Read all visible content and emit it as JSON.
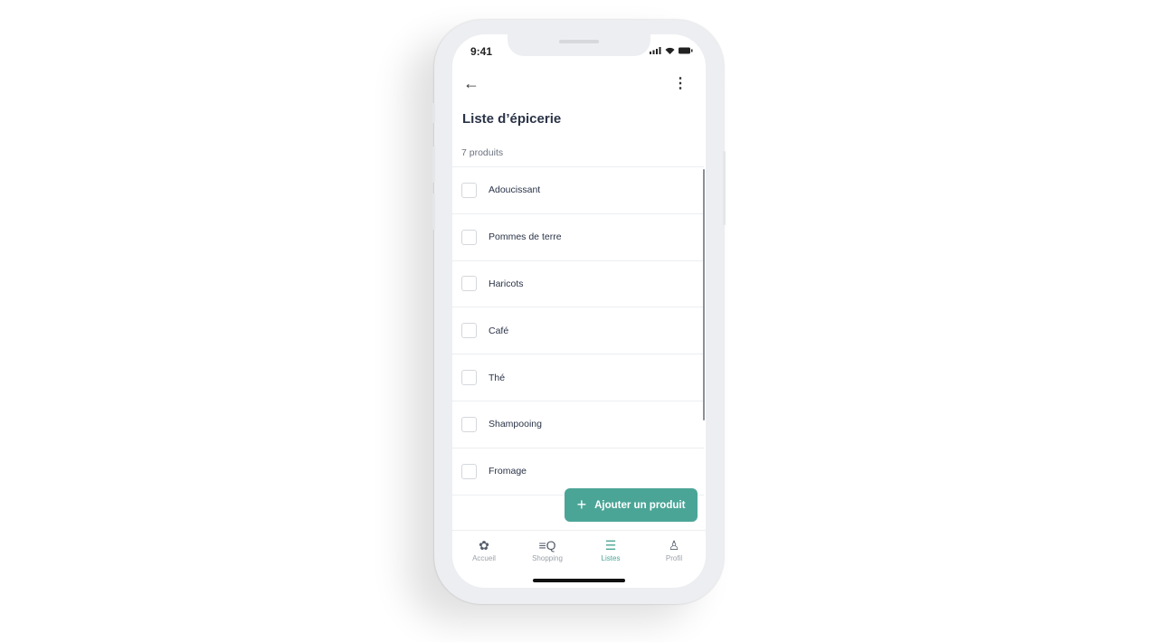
{
  "status_bar": {
    "time": "9:41"
  },
  "header": {
    "title": "Liste d’épicerie",
    "count": "7 produits"
  },
  "items": [
    {
      "label": "Adoucissant",
      "checked": false
    },
    {
      "label": "Pommes de terre",
      "checked": false
    },
    {
      "label": "Haricots",
      "checked": false
    },
    {
      "label": "Café",
      "checked": false
    },
    {
      "label": "Thé",
      "checked": false
    },
    {
      "label": "Shampooing",
      "checked": false
    },
    {
      "label": "Fromage",
      "checked": false
    }
  ],
  "fab": {
    "label": "Ajouter un produit",
    "icon": "plus-icon"
  },
  "tabs": [
    {
      "label": "Accueil",
      "icon": "home-blob-icon"
    },
    {
      "label": "Shopping",
      "icon": "search-list-icon"
    },
    {
      "label": "Listes",
      "icon": "list-icon",
      "active": true
    },
    {
      "label": "Profil",
      "icon": "user-icon"
    }
  ],
  "colors": {
    "accent": "#4ba597",
    "text": "#2a3347"
  }
}
